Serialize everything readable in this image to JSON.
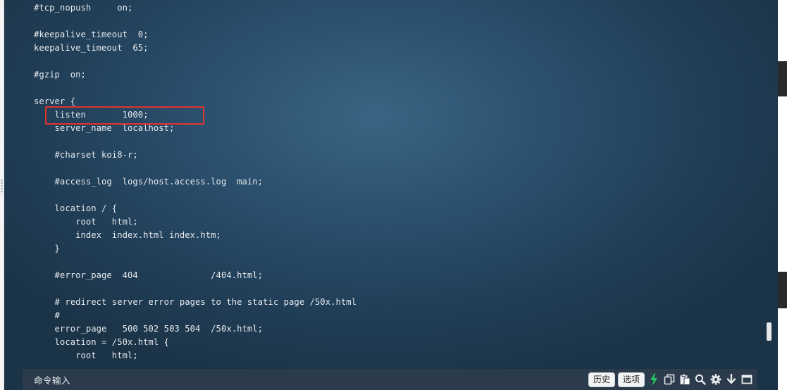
{
  "editor": {
    "lines": [
      "#tcp_nopush     on;",
      "",
      "#keepalive_timeout  0;",
      "keepalive_timeout  65;",
      "",
      "#gzip  on;",
      "",
      "server {",
      "    listen       1000;",
      "    server_name  localhost;",
      "",
      "    #charset koi8-r;",
      "",
      "    #access_log  logs/host.access.log  main;",
      "",
      "    location / {",
      "        root   html;",
      "        index  index.html index.htm;",
      "    }",
      "",
      "    #error_page  404              /404.html;",
      "",
      "    # redirect server error pages to the static page /50x.html",
      "    #",
      "    error_page   500 502 503 504  /50x.html;",
      "    location = /50x.html {",
      "        root   html;"
    ]
  },
  "command_bar": {
    "label": "命令输入",
    "input_value": "",
    "history_label": "历史",
    "options_label": "选项"
  },
  "icons": {
    "lightning": "lightning-icon",
    "copy": "copy-icon",
    "paste": "paste-icon",
    "search": "search-icon",
    "settings": "gear-icon",
    "download": "download-icon",
    "window": "window-icon"
  },
  "colors": {
    "terminal_bg": "#2c5170",
    "text": "#e8eef4",
    "highlight": "#e0332f",
    "lightning": "#22c55e"
  }
}
